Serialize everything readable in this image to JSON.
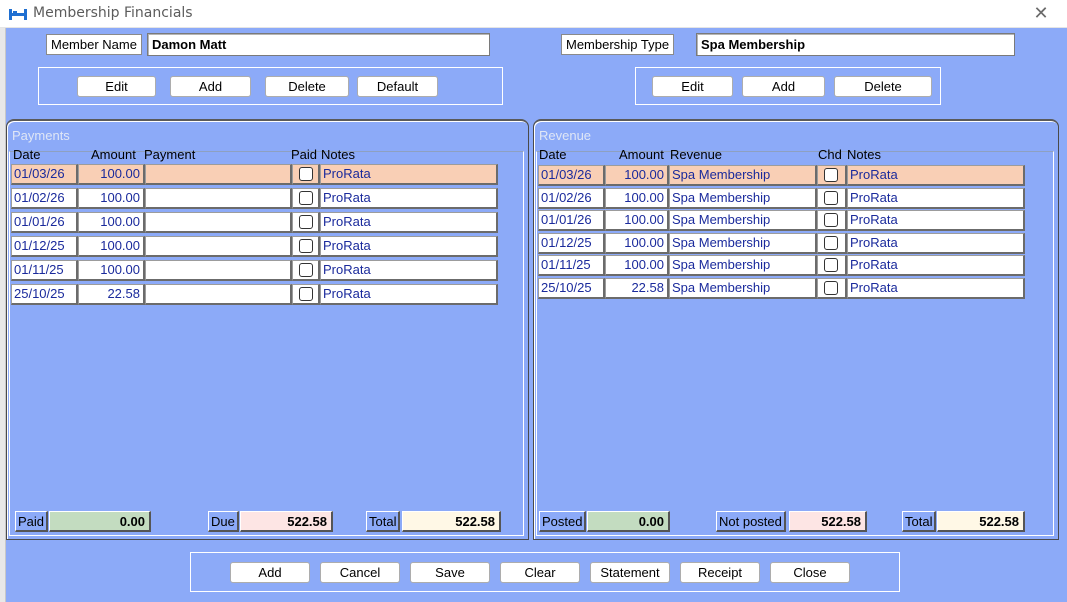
{
  "window": {
    "title": "Membership Financials",
    "close_glyph": "✕"
  },
  "colors": {
    "window_bg": "#8caaf8",
    "selected_row": "#f9cfb5",
    "paid_box": "#c3dcc0",
    "due_box": "#fde5e4",
    "total_box": "#fff8e6",
    "cell_text": "#1a2a9c"
  },
  "member": {
    "label": "Member Name",
    "value": "Damon Matt",
    "buttons": [
      "Edit",
      "Add",
      "Delete",
      "Default"
    ]
  },
  "membership": {
    "label": "Membership Type",
    "value": "Spa Membership",
    "buttons": [
      "Edit",
      "Add",
      "Delete"
    ]
  },
  "payments": {
    "title": "Payments",
    "headers": [
      "Date",
      "Amount",
      "Payment",
      "Paid",
      "Notes"
    ],
    "rows": [
      {
        "date": "01/03/26",
        "amount": "100.00",
        "payment": "",
        "paid": false,
        "notes": "ProRata",
        "selected": true
      },
      {
        "date": "01/02/26",
        "amount": "100.00",
        "payment": "",
        "paid": false,
        "notes": "ProRata",
        "selected": false
      },
      {
        "date": "01/01/26",
        "amount": "100.00",
        "payment": "",
        "paid": false,
        "notes": "ProRata",
        "selected": false
      },
      {
        "date": "01/12/25",
        "amount": "100.00",
        "payment": "",
        "paid": false,
        "notes": "ProRata",
        "selected": false
      },
      {
        "date": "01/11/25",
        "amount": "100.00",
        "payment": "",
        "paid": false,
        "notes": "ProRata",
        "selected": false
      },
      {
        "date": "25/10/25",
        "amount": "22.58",
        "payment": "",
        "paid": false,
        "notes": "ProRata",
        "selected": false
      }
    ],
    "totals": {
      "paid_label": "Paid",
      "paid_value": "0.00",
      "due_label": "Due",
      "due_value": "522.58",
      "total_label": "Total",
      "total_value": "522.58"
    }
  },
  "revenue": {
    "title": "Revenue",
    "headers": [
      "Date",
      "Amount",
      "Revenue",
      "Chd",
      "Notes"
    ],
    "rows": [
      {
        "date": "01/03/26",
        "amount": "100.00",
        "revenue": "Spa Membership",
        "chd": false,
        "notes": "ProRata",
        "selected": true
      },
      {
        "date": "01/02/26",
        "amount": "100.00",
        "revenue": "Spa Membership",
        "chd": false,
        "notes": "ProRata",
        "selected": false
      },
      {
        "date": "01/01/26",
        "amount": "100.00",
        "revenue": "Spa Membership",
        "chd": false,
        "notes": "ProRata",
        "selected": false
      },
      {
        "date": "01/12/25",
        "amount": "100.00",
        "revenue": "Spa Membership",
        "chd": false,
        "notes": "ProRata",
        "selected": false
      },
      {
        "date": "01/11/25",
        "amount": "100.00",
        "revenue": "Spa Membership",
        "chd": false,
        "notes": "ProRata",
        "selected": false
      },
      {
        "date": "25/10/25",
        "amount": "22.58",
        "revenue": "Spa Membership",
        "chd": false,
        "notes": "ProRata",
        "selected": false
      }
    ],
    "totals": {
      "posted_label": "Posted",
      "posted_value": "0.00",
      "not_posted_label": "Not posted",
      "not_posted_value": "522.58",
      "total_label": "Total",
      "total_value": "522.58"
    }
  },
  "footer": {
    "buttons": [
      "Add",
      "Cancel",
      "Save",
      "Clear",
      "Statement",
      "Receipt",
      "Close"
    ]
  }
}
